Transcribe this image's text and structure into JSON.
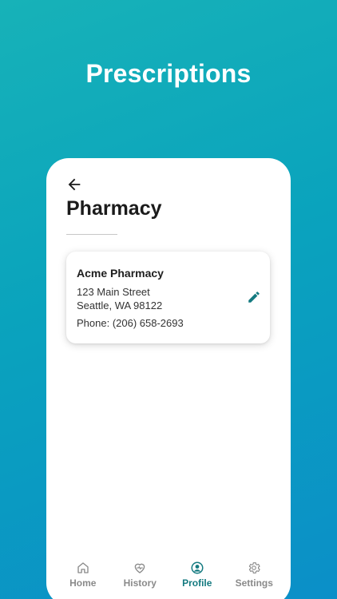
{
  "promo": {
    "headline": "Prescriptions"
  },
  "screen": {
    "title": "Pharmacy"
  },
  "pharmacy": {
    "name": "Acme Pharmacy",
    "address_line1": "123 Main Street",
    "address_line2": "Seattle, WA 98122",
    "phone": "Phone: (206) 658-2693"
  },
  "tabs": [
    {
      "label": "Home",
      "icon": "home-icon",
      "active": false
    },
    {
      "label": "History",
      "icon": "heart-icon",
      "active": false
    },
    {
      "label": "Profile",
      "icon": "profile-icon",
      "active": true
    },
    {
      "label": "Settings",
      "icon": "gear-icon",
      "active": false
    }
  ],
  "colors": {
    "accent": "#147a80",
    "inactive": "#8a8a8a",
    "background_gradient_start": "#17b2b8",
    "background_gradient_end": "#0b8fc8"
  }
}
